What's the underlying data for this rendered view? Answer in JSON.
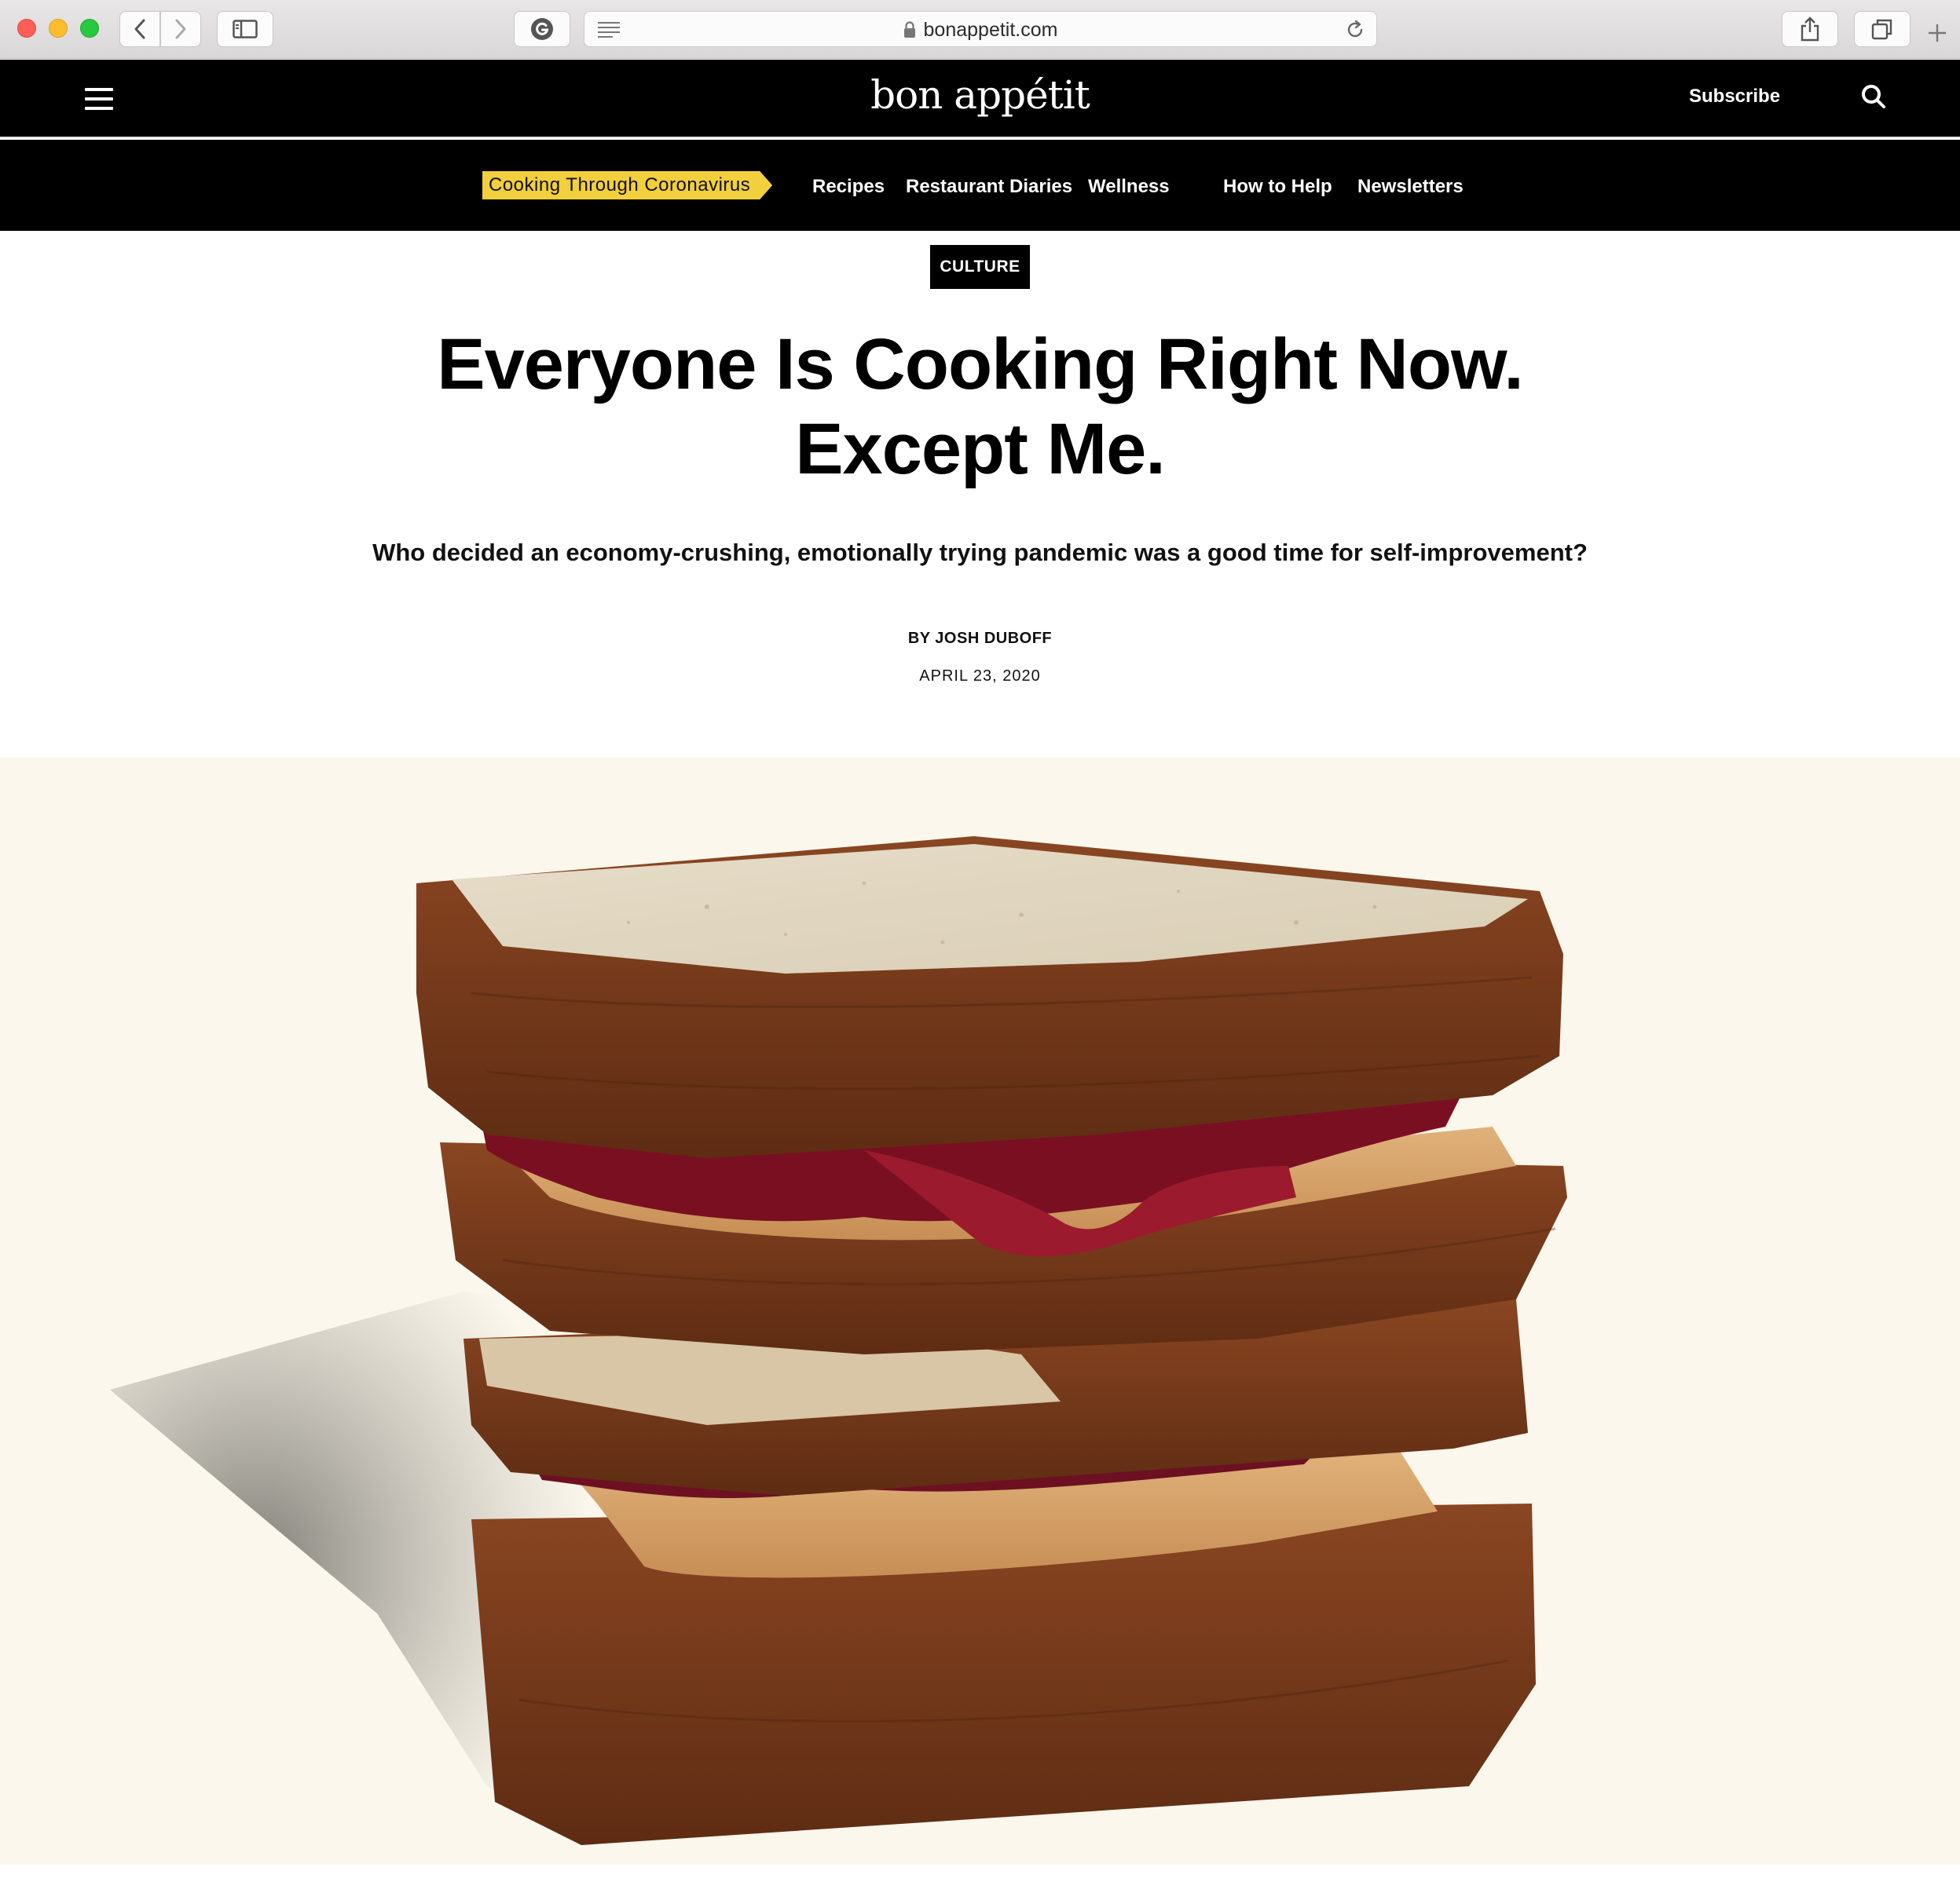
{
  "browser": {
    "url": "bonappetit.com"
  },
  "site": {
    "logo": "bon appétit",
    "subscribe_label": "Subscribe"
  },
  "nav": {
    "special": "Cooking Through Coronavirus",
    "items": [
      "Recipes",
      "Restaurant Diaries",
      "Wellness",
      "How to Help",
      "Newsletters"
    ]
  },
  "article": {
    "tag": "CULTURE",
    "headline_line1": "Everyone Is Cooking Right Now.",
    "headline_line2": "Except Me.",
    "dek": "Who decided an economy-crushing, emotionally trying pandemic was a good time for self-improvement?",
    "byline": "BY JOSH DUBOFF",
    "date": "APRIL 23, 2020"
  },
  "colors": {
    "nav_background": "#000000",
    "special_tag": "#f2cf3c",
    "hero_background": "#fcf7ec"
  },
  "icons": {
    "menu": "hamburger-icon",
    "search": "search-icon",
    "lock": "lock-icon",
    "reload": "reload-icon"
  }
}
